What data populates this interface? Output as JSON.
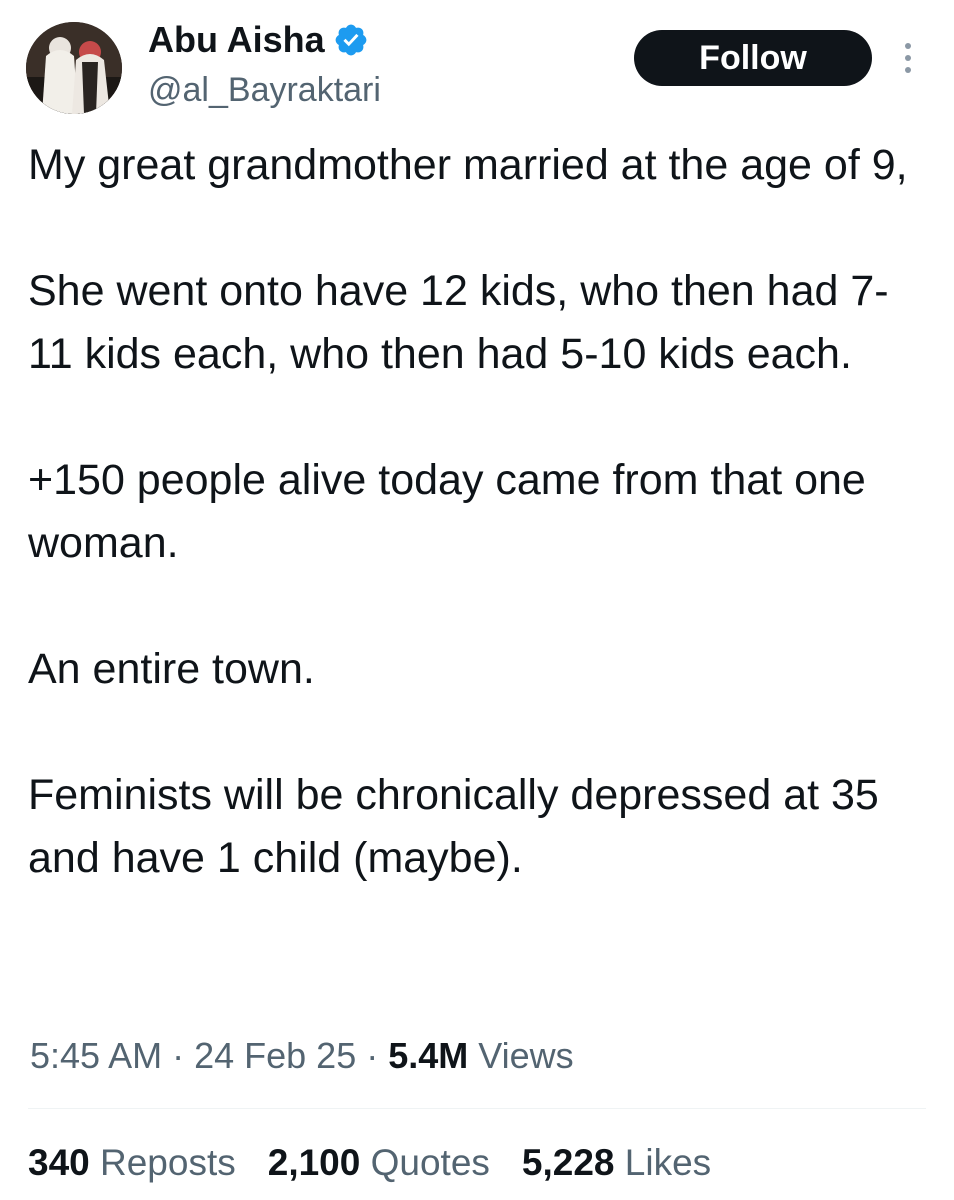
{
  "author": {
    "display_name": "Abu Aisha",
    "handle": "@al_Bayraktari",
    "verified_icon": "verified-badge-icon",
    "verified_color": "#1d9bf0"
  },
  "follow_button": {
    "label": "Follow"
  },
  "more_button": {
    "icon": "more-vertical-icon"
  },
  "tweet": {
    "paragraphs": [
      "My great grandmother married at the age of 9,",
      "She went onto have 12 kids, who then had 7-11 kids each, who then had 5-10 kids each.",
      "+150 people alive today came from that one woman.",
      "An entire town.",
      "Feminists will be chronically depressed at 35 and have 1 child (maybe)."
    ]
  },
  "meta": {
    "time": "5:45 AM",
    "sep1": " · ",
    "date": "24 Feb 25",
    "sep2": " · ",
    "views_count": "5.4M",
    "views_label": " Views"
  },
  "stats": {
    "reposts": {
      "count": "340",
      "label": " Reposts"
    },
    "quotes": {
      "count": "2,100",
      "label": " Quotes"
    },
    "likes": {
      "count": "5,228",
      "label": " Likes"
    }
  },
  "colors": {
    "text_primary": "#0f1419",
    "text_secondary": "#536471",
    "follow_bg": "#0f1419",
    "divider": "#eff3f4"
  }
}
